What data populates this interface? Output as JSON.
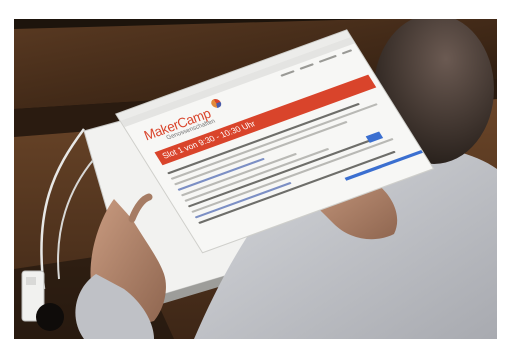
{
  "photo": {
    "subject": "tablet",
    "screen": {
      "logo_text": "MakerCamp",
      "logo_subtitle": "Genossenschaften",
      "banner_text": "Slot 1 von 9:30 - 10:30 Uhr"
    }
  },
  "colors": {
    "brand_red": "#d9442b",
    "link_blue": "#3b6fd0",
    "wood": "#3a2616",
    "skin": "#b98a72"
  }
}
